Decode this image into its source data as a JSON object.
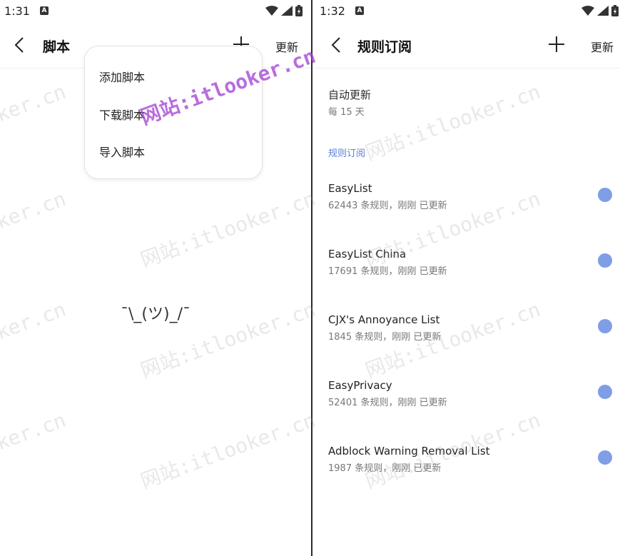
{
  "colors": {
    "accent": "#5b7fd6",
    "toggle": "#7f9ee6",
    "divider": "#2b2b2b"
  },
  "left": {
    "status_time": "1:31",
    "status_badge": "A",
    "title": "脚本",
    "update_label": "更新",
    "menu": {
      "items": [
        "添加脚本",
        "下载脚本",
        "导入脚本"
      ]
    },
    "empty_text": "¯\\_(ツ)_/¯"
  },
  "right": {
    "status_time": "1:32",
    "status_badge": "A",
    "title": "规则订阅",
    "update_label": "更新",
    "auto_update": {
      "label": "自动更新",
      "value": "每 15 天"
    },
    "section_header": "规则订阅",
    "subscriptions": [
      {
        "name": "EasyList",
        "meta": "62443 条规则，刚刚 已更新"
      },
      {
        "name": "EasyList China",
        "meta": "17691 条规则，刚刚 已更新"
      },
      {
        "name": "CJX's Annoyance List",
        "meta": "1845 条规则，刚刚 已更新"
      },
      {
        "name": "EasyPrivacy",
        "meta": "52401 条规则，刚刚 已更新"
      },
      {
        "name": "Adblock Warning Removal List",
        "meta": "1987 条规则，刚刚 已更新"
      }
    ]
  },
  "watermark": {
    "text": "网站:itlooker.cn"
  }
}
